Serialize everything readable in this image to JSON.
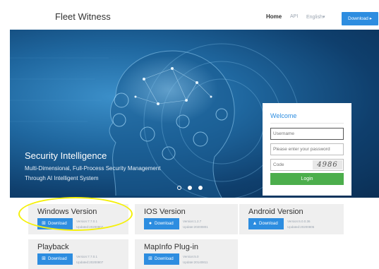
{
  "header": {
    "brand": "Fleet Witness",
    "nav": {
      "home": "Home",
      "api": "API",
      "language": "English"
    },
    "download_label": "Download"
  },
  "hero": {
    "title": "Security Intelligence",
    "subtitle_line1": "Multi-Dimensional, Full-Process Security Management",
    "subtitle_line2": "Through AI Intelligent System",
    "carousel_dots": 3,
    "carousel_active": 2
  },
  "login": {
    "title": "Welcome",
    "username_placeholder": "Username",
    "password_placeholder": "Please enter your password",
    "code_placeholder": "Code",
    "captcha": "4986",
    "button": "Login"
  },
  "downloads": [
    {
      "title": "Windows Version",
      "button": "Download",
      "icon": "windows-icon",
      "version": "Version:7.7.0.1",
      "updated": "Updated:20200807"
    },
    {
      "title": "IOS Version",
      "button": "Download",
      "icon": "apple-icon",
      "version": "Version:1.2.7",
      "updated": "Update:20200801"
    },
    {
      "title": "Android Version",
      "button": "Download",
      "icon": "android-icon",
      "version": "Version:6.0.0.36",
      "updated": "Updated:20200805"
    },
    {
      "title": "Playback",
      "button": "Download",
      "icon": "windows-icon",
      "version": "Version:7.7.0.1",
      "updated": "Updated:20200807"
    },
    {
      "title": "MapInfo Plug-in",
      "button": "Download",
      "icon": "windows-icon",
      "version": "Version:5.0",
      "updated": "Update:20140811"
    }
  ],
  "colors": {
    "accent": "#2d8de0",
    "login_button": "#4cae4c",
    "highlight": "#f5f00a"
  }
}
